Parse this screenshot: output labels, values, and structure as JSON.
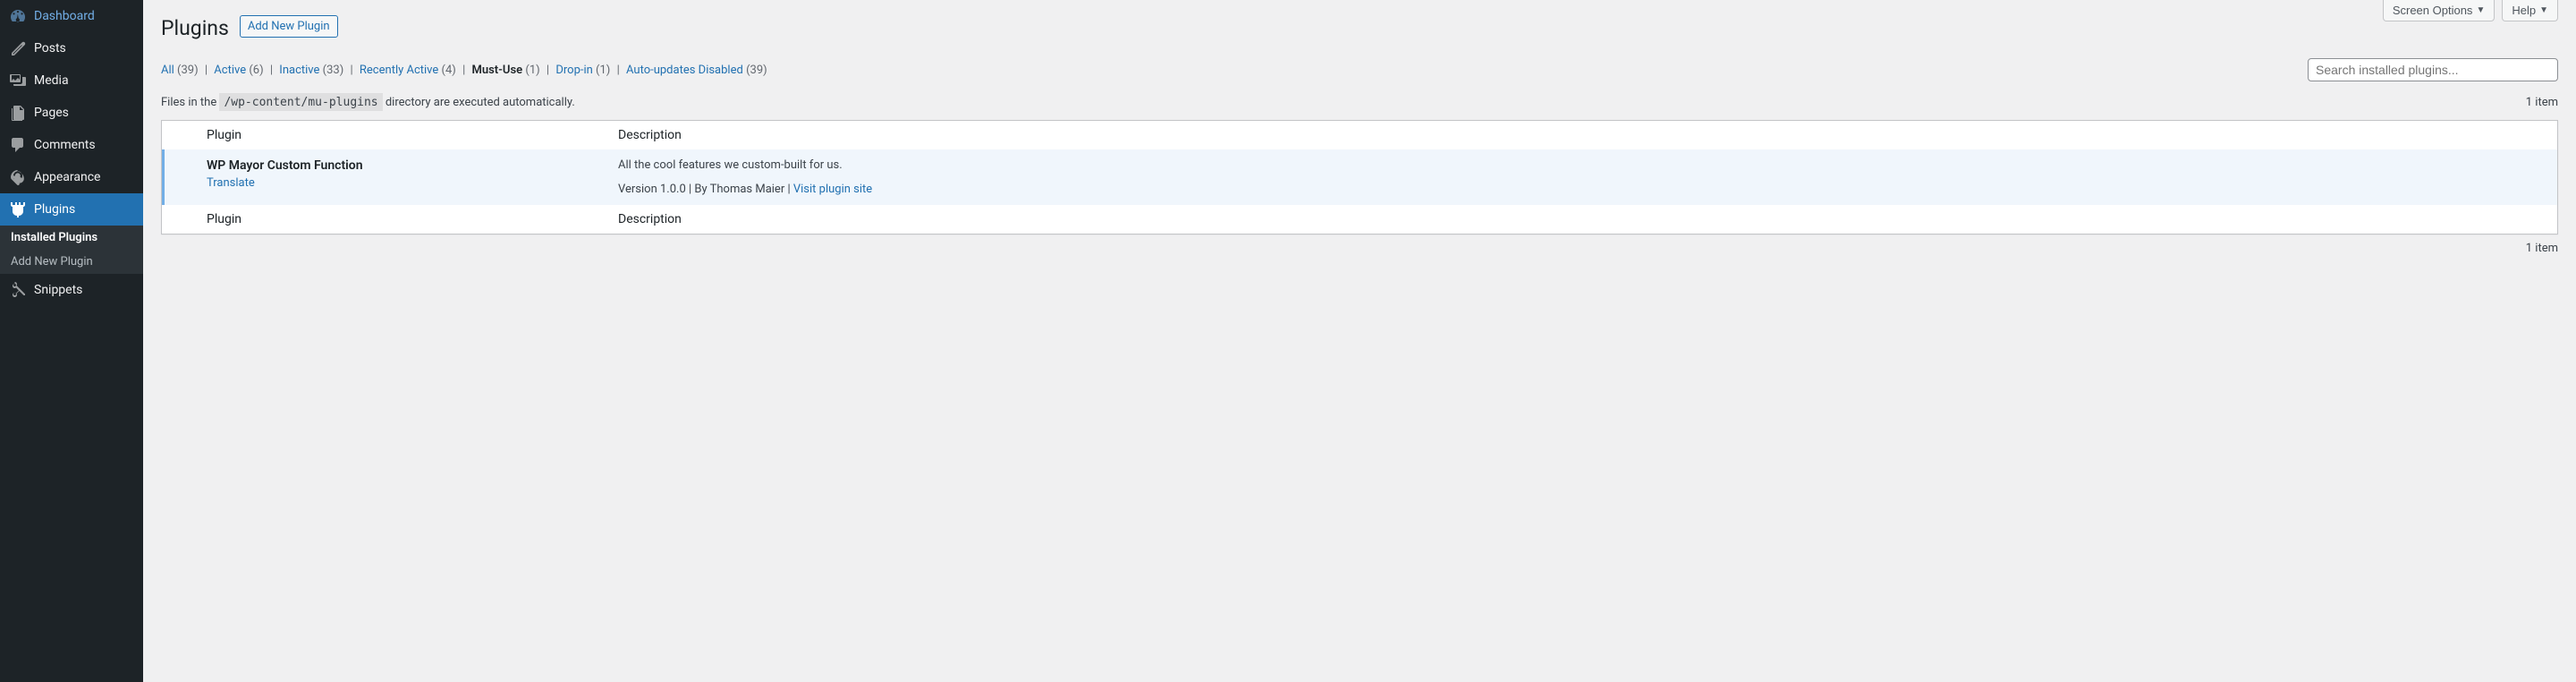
{
  "sidebar": {
    "items": [
      {
        "label": "Dashboard",
        "icon": "dashboard"
      },
      {
        "label": "Posts",
        "icon": "posts"
      },
      {
        "label": "Media",
        "icon": "media"
      },
      {
        "label": "Pages",
        "icon": "pages"
      },
      {
        "label": "Comments",
        "icon": "comments"
      },
      {
        "label": "Appearance",
        "icon": "appearance"
      },
      {
        "label": "Plugins",
        "icon": "plugins"
      },
      {
        "label": "Snippets",
        "icon": "snippets"
      }
    ],
    "submenu": [
      {
        "label": "Installed Plugins"
      },
      {
        "label": "Add New Plugin"
      }
    ]
  },
  "topButtons": {
    "screenOptions": "Screen Options",
    "help": "Help"
  },
  "header": {
    "title": "Plugins",
    "addNew": "Add New Plugin"
  },
  "filters": {
    "all": {
      "label": "All",
      "count": "(39)"
    },
    "active": {
      "label": "Active",
      "count": "(6)"
    },
    "inactive": {
      "label": "Inactive",
      "count": "(33)"
    },
    "recentlyActive": {
      "label": "Recently Active",
      "count": "(4)"
    },
    "mustUse": {
      "label": "Must-Use",
      "count": "(1)"
    },
    "dropIn": {
      "label": "Drop-in",
      "count": "(1)"
    },
    "autoUpdatesDisabled": {
      "label": "Auto-updates Disabled",
      "count": "(39)"
    }
  },
  "search": {
    "placeholder": "Search installed plugins..."
  },
  "note": {
    "prefix": "Files in the ",
    "code": "/wp-content/mu-plugins",
    "suffix": " directory are executed automatically."
  },
  "itemCount": "1 item",
  "table": {
    "colPlugin": "Plugin",
    "colDescription": "Description"
  },
  "plugin": {
    "name": "WP Mayor Custom Function",
    "action": "Translate",
    "description": "All the cool features we custom-built for us.",
    "version": "Version 1.0.0",
    "author": "By Thomas Maier",
    "siteLink": "Visit plugin site",
    "sep": " | "
  }
}
